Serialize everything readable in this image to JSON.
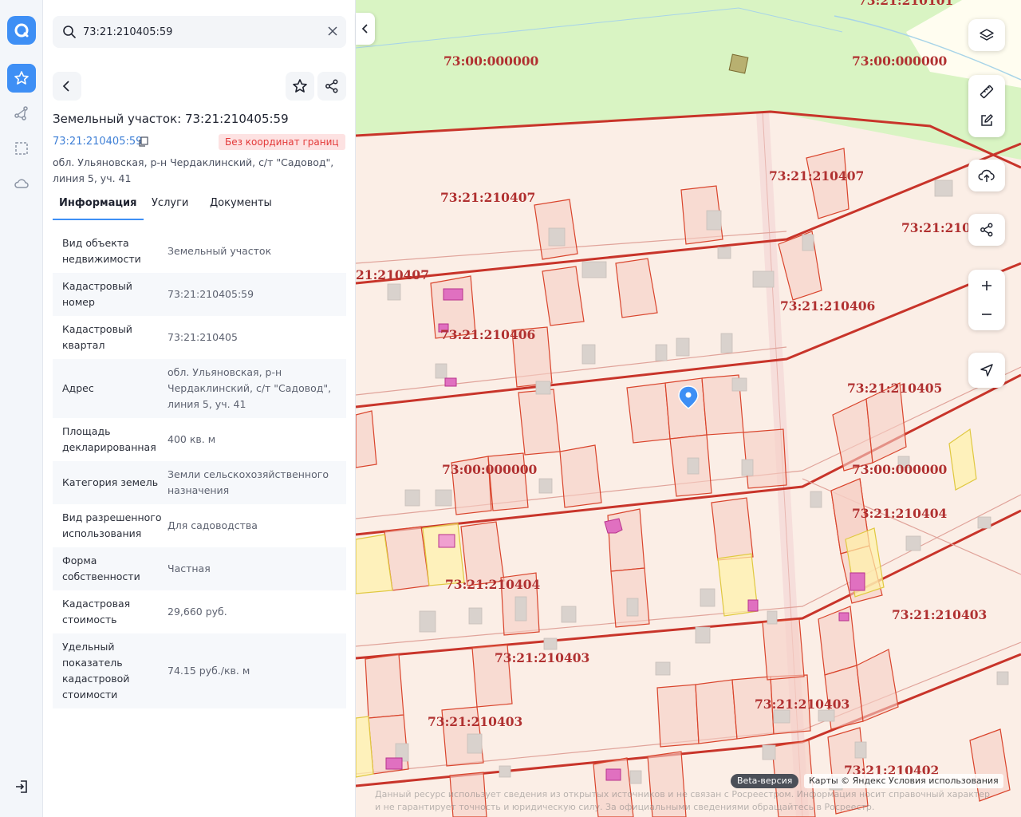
{
  "search": {
    "value": "73:21:210405:59"
  },
  "object": {
    "title": "Земельный участок: 73:21:210405:59",
    "cadastral_link": "73:21:210405:59",
    "badge": "Без координат границ",
    "address": "обл. Ульяновская, р-н Чердаклинский, с/т \"Садовод\", линия 5, уч. 41"
  },
  "tabs": [
    "Информация",
    "Услуги",
    "Документы"
  ],
  "info_rows": [
    {
      "k": "Вид объекта недвижимости",
      "v": "Земельный участок"
    },
    {
      "k": "Кадастровый номер",
      "v": "73:21:210405:59"
    },
    {
      "k": "Кадастровый квартал",
      "v": "73:21:210405"
    },
    {
      "k": "Адрес",
      "v": "обл. Ульяновская, р-н Чердаклинский, с/т \"Садовод\", линия 5, уч. 41"
    },
    {
      "k": "Площадь декларированная",
      "v": "400 кв. м"
    },
    {
      "k": "Категория земель",
      "v": "Земли сельскохозяйственного назначения"
    },
    {
      "k": "Вид разрешенного использования",
      "v": "Для садоводства"
    },
    {
      "k": "Форма собственности",
      "v": "Частная"
    },
    {
      "k": "Кадастровая стоимость",
      "v": "29,660 руб."
    },
    {
      "k": "Удельный показатель кадастровой стоимости",
      "v": "74.15 руб./кв. м"
    }
  ],
  "map": {
    "labels": [
      "73:00:000000",
      "73:00:000000",
      "73:21:210101",
      "73:21:210407",
      "73:21:210407",
      "21:210407",
      "73:21:210",
      "73:21:210406",
      "73:21:210406",
      "73:21:210405",
      "73:00:000000",
      "73:00:000000",
      "73:21:210404",
      "73:21:210404",
      "73:21:210403",
      "73:21:210403",
      "73:21:210403",
      "73:21:210403",
      "73:21:210402"
    ],
    "beta": "Beta-версия",
    "attribution": "Карты © Яндекс   Условия использования",
    "footer": "Данный ресурс использует сведения из открытых источников и не связан с Росреестром. Информация носит справочный характер и не гарантирует точность и юридическую силу. За официальными сведениями обращайтесь в Росреестр."
  },
  "colors": {
    "accent": "#3e8ff5",
    "badge_text": "#e33a3a",
    "parcel": "#d9442c",
    "green_area": "#d8f5c0"
  },
  "icons": {
    "rail": [
      "logo-icon",
      "star-icon",
      "route-icon",
      "selection-icon",
      "cloud-icon",
      "logout-icon"
    ],
    "map_controls": [
      "layers-icon",
      "ruler-icon",
      "edit-icon",
      "upload-icon",
      "share-icon",
      "zoom-in-icon",
      "zoom-out-icon",
      "locate-icon"
    ]
  }
}
